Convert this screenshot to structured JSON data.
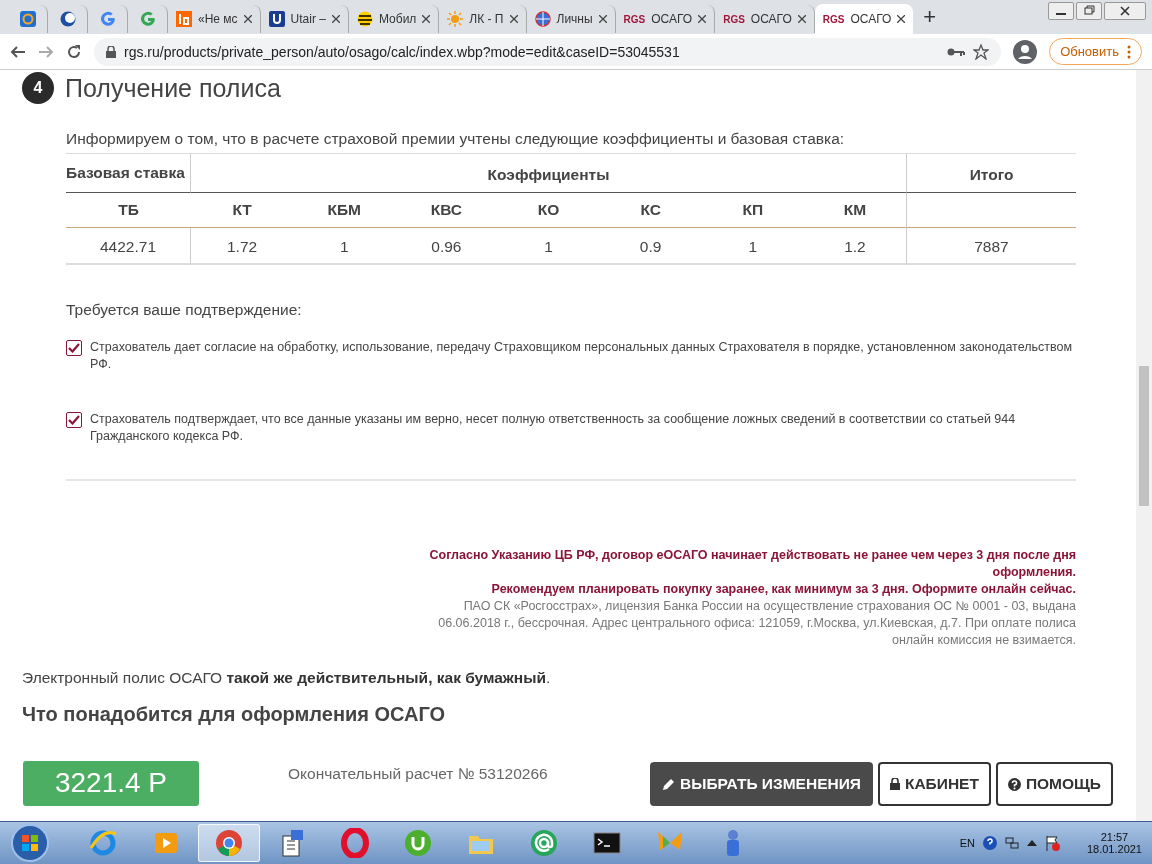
{
  "browser": {
    "tabs": [
      {
        "selected": false
      },
      {
        "selected": false
      },
      {
        "selected": false
      },
      {
        "selected": false
      },
      {
        "title": "«Не мс",
        "selected": false
      },
      {
        "title": "Utair –",
        "selected": false
      },
      {
        "title": "Мобил",
        "selected": false
      },
      {
        "title": "ЛК - П",
        "selected": false
      },
      {
        "title": "Личны",
        "selected": false
      },
      {
        "logo": "RGS",
        "title": "ОСАГО",
        "selected": false
      },
      {
        "logo": "RGS",
        "title": "ОСАГО",
        "selected": false
      },
      {
        "logo": "RGS",
        "title": "ОСАГО",
        "selected": true
      }
    ],
    "new_tab": "+",
    "url": "rgs.ru/products/private_person/auto/osago/calc/index.wbp?mode=edit&caseID=53045531",
    "update_button": "Обновить"
  },
  "section": {
    "number": "4",
    "title": "Получение полиса",
    "intro": "Информируем о том, что в расчете страховой премии учтены следующие коэффициенты и базовая ставка:",
    "table": {
      "group_headers": [
        "Базовая ставка",
        "Коэффициенты",
        "Итого"
      ],
      "columns": [
        "ТБ",
        "КТ",
        "КБМ",
        "КВС",
        "КО",
        "КС",
        "КП",
        "КМ"
      ],
      "row": [
        "4422.71",
        "1.72",
        "1",
        "0.96",
        "1",
        "0.9",
        "1",
        "1.2",
        "7887"
      ]
    },
    "confirm_label": "Требуется ваше подтверждение:",
    "checkboxes": [
      {
        "text": "Страхователь дает согласие на обработку, использование, передачу Страховщиком персональных данных Страхователя в порядке, установленном законодательством РФ.",
        "checked": true
      },
      {
        "text": "Страхователь подтверждает, что все данные указаны им верно, несет полную ответственность за сообщение ложных сведений в соответствии со статьей 944 Гражданского кодекса РФ.",
        "checked": true
      }
    ]
  },
  "notice": {
    "warnings": [
      "Согласно Указанию ЦБ РФ, договор еОСАГО начинает действовать не ранее чем через 3 дня после дня оформления.",
      "Рекомендуем планировать покупку заранее, как минимум за 3 дня. Оформите онлайн сейчас."
    ],
    "license": "ПАО СК «Росгосстрах», лицензия Банка России на осуществление страхования ОС № 0001 - 03, выдана 06.06.2018 г., бессрочная. Адрес центрального офиса: 121059, г.Москва, ул.Киевская, д.7. При оплате полиса онлайн комиссия не взимается."
  },
  "electronic_note": "Электронный полис ОСАГО **такой же действительный, как бумажный**.",
  "next_heading": "Что понадобится для оформления ОСАГО",
  "bottom_bar": {
    "price": "3221.4 Р",
    "calc": "Окончательный расчет № 53120266",
    "buttons": [
      {
        "label": "ВЫБРАТЬ ИЗМЕНЕНИЯ",
        "kind": "edit"
      },
      {
        "label": "КАБИНЕТ",
        "kind": "lock"
      },
      {
        "label": "ПОМОЩЬ",
        "kind": "help"
      }
    ]
  },
  "taskbar": {
    "apps": [
      {
        "selected": false
      },
      {
        "selected": false
      },
      {
        "selected": true
      },
      {
        "selected": false
      },
      {
        "selected": false
      },
      {
        "selected": false
      },
      {
        "selected": false
      },
      {
        "selected": false
      },
      {
        "selected": false
      },
      {
        "selected": false
      },
      {
        "selected": false
      }
    ],
    "lang": "EN",
    "time": "21:57",
    "date": "18.01.2021"
  }
}
